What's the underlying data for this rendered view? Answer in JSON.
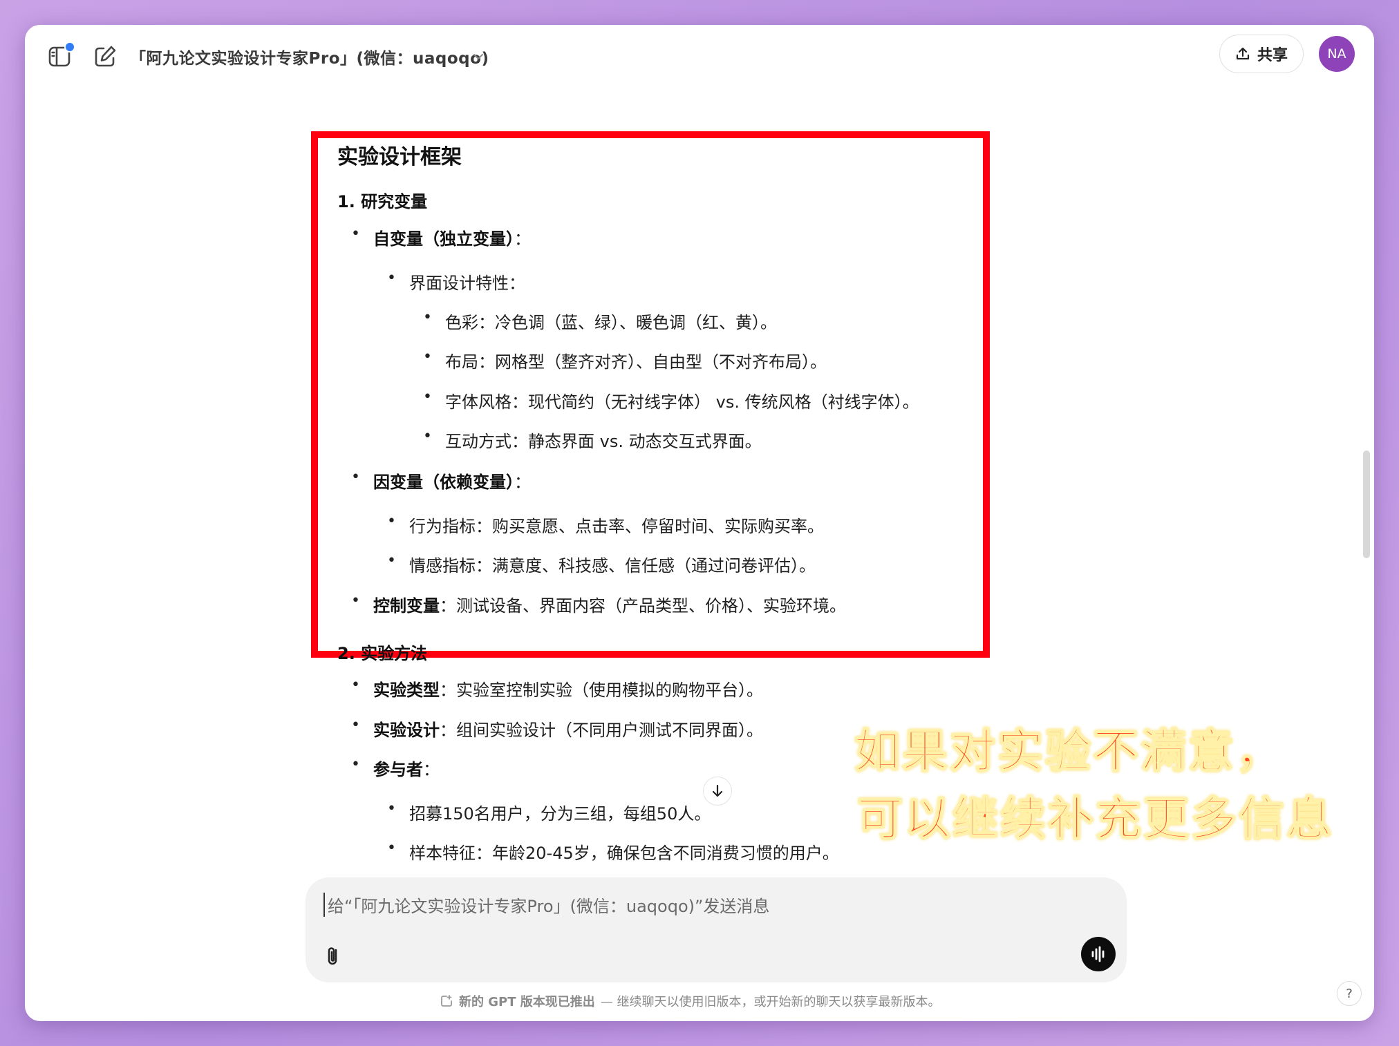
{
  "header": {
    "gpt_title": "「阿九论文实验设计专家Pro」(微信：uaqoqo)",
    "share_label": "共享",
    "avatar_initials": "NA"
  },
  "message": {
    "section_title": "实验设计框架",
    "s1_heading": "1. 研究变量",
    "iv_label": "自变量（独立变量）",
    "iv_colon": "：",
    "ui_features": "界面设计特性：",
    "color_label": "色彩：",
    "color_text": "冷色调（蓝、绿）、暖色调（红、黄）。",
    "layout_label": "布局：",
    "layout_text": "网格型（整齐对齐）、自由型（不对齐布局）。",
    "font_label": "字体风格：",
    "font_text": "现代简约（无衬线字体） vs. 传统风格（衬线字体）。",
    "interaction_label": "互动方式：",
    "interaction_text": "静态界面 vs. 动态交互式界面。",
    "dv_label": "因变量（依赖变量）",
    "dv_colon": "：",
    "behavior": "行为指标：购买意愿、点击率、停留时间、实际购买率。",
    "emotion": "情感指标：满意度、科技感、信任感（通过问卷评估）。",
    "cv_label": "控制变量",
    "cv_text": "：测试设备、界面内容（产品类型、价格）、实验环境。",
    "s2_heading": "2. 实验方法",
    "type_label": "实验类型",
    "type_text": "：实验室控制实验（使用模拟的购物平台）。",
    "design_label": "实验设计",
    "design_text": "：组间实验设计（不同用户测试不同界面）。",
    "participants_label": "参与者",
    "participants_colon": "：",
    "recruit": "招募150名用户，分为三组，每组50人。",
    "sample": "样本特征：年龄20-45岁，确保包含不同消费习惯的用户。"
  },
  "overlay": {
    "line1": "如果对实验不满意，",
    "line2": "可以继续补充更多信息"
  },
  "composer": {
    "placeholder": "给“「阿九论文实验设计专家Pro」(微信：uaqoqo)”发送消息"
  },
  "footer": {
    "notice_bold": "新的 GPT 版本现已推出",
    "notice_rest": " — 继续聊天以使用旧版本，或开始新的聊天以获享最新版本。",
    "help": "?"
  },
  "colors": {
    "highlight_border": "#ff0010",
    "overlay_text": "#ff4a20",
    "avatar_bg": "#8e44b8"
  }
}
